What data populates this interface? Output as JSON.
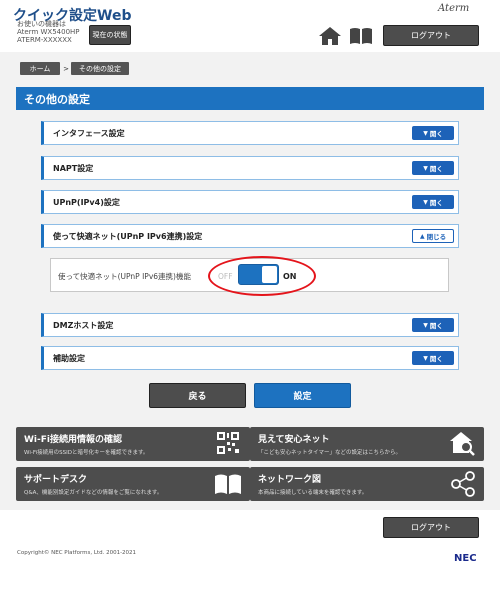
{
  "header": {
    "title": "クイック設定Web",
    "device_lines": [
      "お使いの機器は",
      "Aterm WX5400HP",
      "ATERM-XXXXXX"
    ],
    "status_button": "現在の状態",
    "brand": "Aterm",
    "logout": "ログアウト"
  },
  "breadcrumb": {
    "home": "ホーム",
    "sep": ">",
    "current": "その他の設定"
  },
  "panel": {
    "title": "その他の設定"
  },
  "sections": [
    {
      "label": "インタフェース設定",
      "button": "開く"
    },
    {
      "label": "NAPT設定",
      "button": "開く"
    },
    {
      "label": "UPnP(IPv4)設定",
      "button": "開く"
    },
    {
      "label": "使って快適ネット(UPnP IPv6連携)設定",
      "button": "閉じる"
    },
    {
      "label": "DMZホスト設定",
      "button": "開く"
    },
    {
      "label": "補助設定",
      "button": "開く"
    }
  ],
  "ipv6_setting": {
    "label": "使って快適ネット(UPnP IPv6連携)機能",
    "off": "OFF",
    "on": "ON"
  },
  "actions": {
    "back": "戻る",
    "set": "設定"
  },
  "tiles": [
    {
      "title": "Wi-Fi接続用情報の確認",
      "desc": "Wi-Fi接続用のSSIDと暗号化キーを確認できます。"
    },
    {
      "title": "見えて安心ネット",
      "desc": "「こども安心ネットタイマー」などの設定はこちらから。"
    },
    {
      "title": "サポートデスク",
      "desc": "Q&A、機能別設定ガイドなどの情報をご覧になれます。"
    },
    {
      "title": "ネットワーク図",
      "desc": "本商品に接続している端末を確認できます。"
    }
  ],
  "footer": {
    "logout": "ログアウト",
    "copyright": "Copyright© NEC Platforms, Ltd. 2001-2021",
    "logo": "NEC"
  },
  "colors": {
    "accent": "#1d72c0",
    "dark_button": "#4d4d4d",
    "highlight": "#e4141b"
  }
}
